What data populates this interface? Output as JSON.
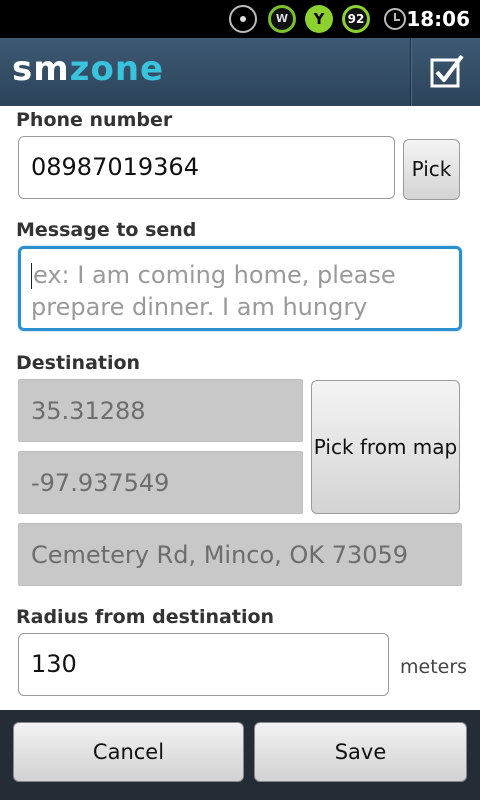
{
  "status_bar": {
    "w_badge": "W",
    "y_badge": "Y",
    "battery_level": "92",
    "time": "18:06"
  },
  "title_bar": {
    "logo_sm": "sm",
    "logo_zone": "zone",
    "check_icon": "checkbox-check-icon",
    "accent_color": "#39c3dc"
  },
  "form": {
    "phone": {
      "label": "Phone number",
      "value": "08987019364",
      "pick_label": "Pick"
    },
    "message": {
      "label": "Message to send",
      "placeholder": "ex: I am coming home, please prepare dinner. I am hungry"
    },
    "destination": {
      "label": "Destination",
      "latitude": "35.31288",
      "longitude": "-97.937549",
      "address": "Cemetery Rd, Minco, OK 73059",
      "pick_map_label": "Pick from map"
    },
    "radius": {
      "label": "Radius from destination",
      "value": "130",
      "unit": "meters"
    }
  },
  "actions": {
    "cancel_label": "Cancel",
    "save_label": "Save"
  }
}
